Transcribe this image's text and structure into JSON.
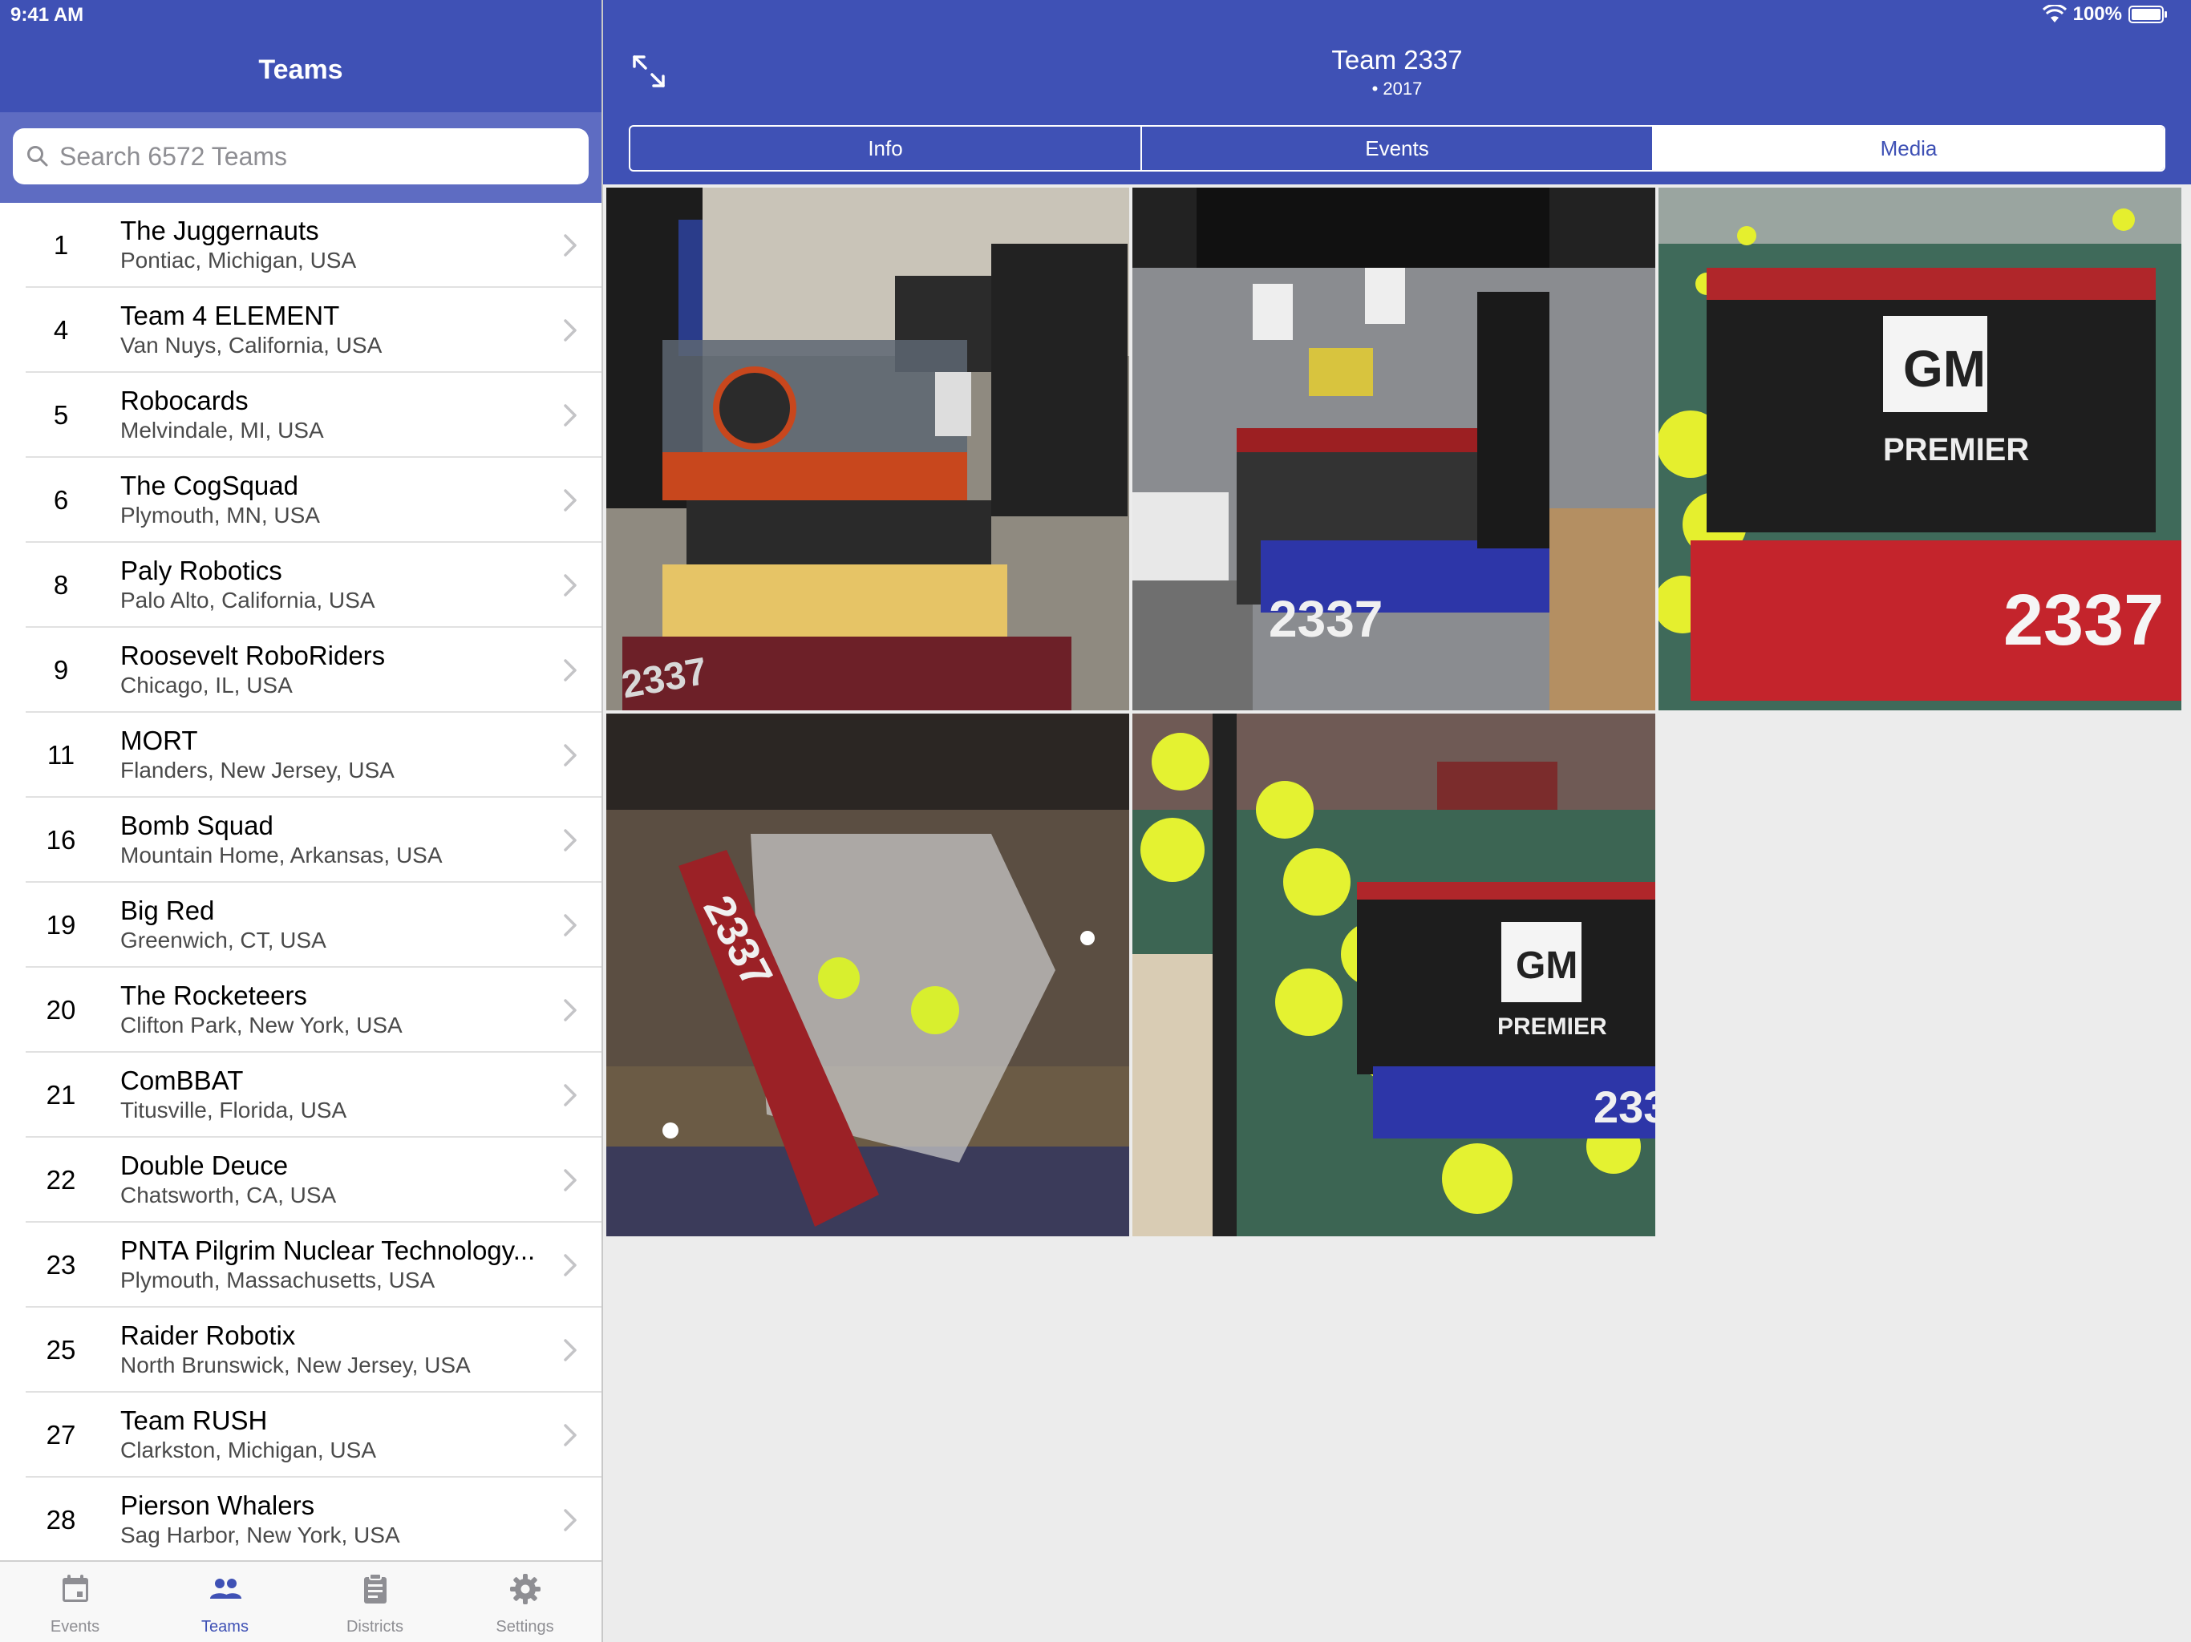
{
  "status_bar": {
    "time": "9:41 AM",
    "battery": "100%"
  },
  "left": {
    "title": "Teams",
    "search": {
      "placeholder": "Search 6572 Teams",
      "value": ""
    },
    "teams": [
      {
        "number": "1",
        "name": "The Juggernauts",
        "location": "Pontiac, Michigan, USA"
      },
      {
        "number": "4",
        "name": "Team 4 ELEMENT",
        "location": "Van Nuys, California, USA"
      },
      {
        "number": "5",
        "name": "Robocards",
        "location": "Melvindale, MI, USA"
      },
      {
        "number": "6",
        "name": "The CogSquad",
        "location": "Plymouth, MN, USA"
      },
      {
        "number": "8",
        "name": "Paly Robotics",
        "location": "Palo Alto, California, USA"
      },
      {
        "number": "9",
        "name": "Roosevelt RoboRiders",
        "location": "Chicago, IL, USA"
      },
      {
        "number": "11",
        "name": "MORT",
        "location": "Flanders, New Jersey, USA"
      },
      {
        "number": "16",
        "name": "Bomb Squad",
        "location": "Mountain Home, Arkansas, USA"
      },
      {
        "number": "19",
        "name": "Big Red",
        "location": "Greenwich, CT, USA"
      },
      {
        "number": "20",
        "name": "The Rocketeers",
        "location": "Clifton Park, New York, USA"
      },
      {
        "number": "21",
        "name": "ComBBAT",
        "location": "Titusville, Florida, USA"
      },
      {
        "number": "22",
        "name": "Double Deuce",
        "location": "Chatsworth, CA, USA"
      },
      {
        "number": "23",
        "name": "PNTA Pilgrim Nuclear Technology...",
        "location": "Plymouth, Massachusetts, USA"
      },
      {
        "number": "25",
        "name": "Raider Robotix",
        "location": "North Brunswick, New Jersey, USA"
      },
      {
        "number": "27",
        "name": "Team RUSH",
        "location": "Clarkston, Michigan, USA"
      },
      {
        "number": "28",
        "name": "Pierson Whalers",
        "location": "Sag Harbor, New York, USA"
      }
    ],
    "tabs": [
      {
        "label": "Events",
        "icon": "calendar-icon"
      },
      {
        "label": "Teams",
        "icon": "people-icon",
        "active": true
      },
      {
        "label": "Districts",
        "icon": "clipboard-icon"
      },
      {
        "label": "Settings",
        "icon": "gear-icon"
      }
    ]
  },
  "right": {
    "title": "Team 2337",
    "subtitle": "• 2017",
    "segments": [
      {
        "label": "Info"
      },
      {
        "label": "Events"
      },
      {
        "label": "Media",
        "active": true
      }
    ],
    "media": [
      {
        "name": "media-photo-1",
        "robot_number": "2337"
      },
      {
        "name": "media-photo-2",
        "robot_number": "2337"
      },
      {
        "name": "media-photo-3",
        "robot_number": "2337",
        "brand": "GM",
        "sponsor": "PREMIER"
      },
      {
        "name": "media-photo-4",
        "robot_number": "2337"
      },
      {
        "name": "media-photo-5",
        "robot_number": "233",
        "brand": "GM",
        "sponsor": "PREMIER"
      }
    ]
  },
  "colors": {
    "primary": "#3f51b5",
    "search_bar_bg": "#5e6cc2",
    "tab_inactive": "#8e8e93"
  }
}
